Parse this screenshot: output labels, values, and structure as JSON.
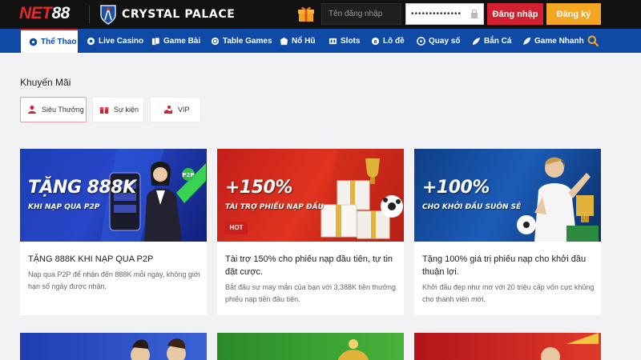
{
  "header": {
    "logo_text_a": "NET",
    "logo_text_b": "88",
    "partner": "CRYSTAL PALACE",
    "username_placeholder": "Tên đăng nhập",
    "password_value": "••••••••••••••",
    "login_label": "Đăng nhập",
    "register_label": "Đăng ký"
  },
  "nav": {
    "items": [
      {
        "label": "Thể Thao",
        "icon": "soccer-ball-icon"
      },
      {
        "label": "Live Casino",
        "icon": "live-casino-icon"
      },
      {
        "label": "Game Bài",
        "icon": "cards-icon"
      },
      {
        "label": "Table Games",
        "icon": "table-games-icon"
      },
      {
        "label": "Nổ Hũ",
        "icon": "jackpot-icon"
      },
      {
        "label": "Slots",
        "icon": "slots-icon"
      },
      {
        "label": "Lô đề",
        "icon": "lottery-ball-icon"
      },
      {
        "label": "Quay số",
        "icon": "lucky-draw-icon"
      },
      {
        "label": "Bắn Cá",
        "icon": "fish-icon"
      },
      {
        "label": "Game Nhanh",
        "icon": "rocket-icon"
      }
    ]
  },
  "promotions": {
    "title": "Khuyến Mãi",
    "filters": [
      {
        "label": "Siêu Thưởng",
        "icon": "user-reward-icon"
      },
      {
        "label": "Sự kiện",
        "icon": "gift-box-icon"
      },
      {
        "label": "VIP",
        "icon": "vip-hand-icon"
      }
    ],
    "cards": [
      {
        "banner_headline": "TẶNG 888K",
        "banner_sub": "KHI NẠP QUA P2P",
        "title": "TẶNG 888K KHI NẠP QUA P2P",
        "desc": "Nạp qua P2P để nhận đến 888K mỗi ngày, không giới hạn số ngày được nhận."
      },
      {
        "banner_headline": "+150%",
        "banner_sub": "TÀI TRỢ PHIẾU NẠP ĐẦU",
        "badge": "HOT",
        "title": "Tài trợ 150% cho phiếu nạp đầu tiên, tự tin đặt cược.",
        "desc": "Bắt đầu sự may mắn của bạn với 3,388K tiền thưởng phiếu nạp tiền đầu tiên."
      },
      {
        "banner_headline": "+100%",
        "banner_sub": "CHO KHỞI ĐẦU SUÔN SẺ",
        "title": "Tặng 100% giá trị phiếu nạp cho khởi đầu thuận lợi.",
        "desc": "Khởi đầu đẹp như mơ với 20 triệu cấp vốn cực khủng cho thành viên mới."
      }
    ]
  },
  "colors": {
    "brand_red": "#d2202f",
    "nav_blue": "#0f4aa6",
    "register_orange": "#f5a623"
  }
}
